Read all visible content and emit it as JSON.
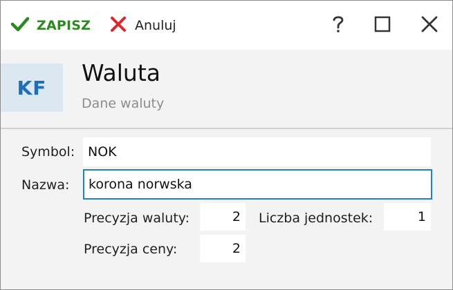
{
  "toolbar": {
    "save_label": "ZAPISZ",
    "cancel_label": "Anuluj"
  },
  "header": {
    "badge": "KF",
    "title": "Waluta",
    "subtitle": "Dane waluty"
  },
  "form": {
    "symbol": {
      "label": "Symbol:",
      "value": "NOK"
    },
    "name": {
      "label": "Nazwa:",
      "value": "korona norwska"
    },
    "currency_precision": {
      "label": "Precyzja waluty:",
      "value": "2"
    },
    "unit_count": {
      "label": "Liczba jednostek:",
      "value": "1"
    },
    "price_precision": {
      "label": "Precyzja ceny:",
      "value": "2"
    }
  },
  "colors": {
    "save_accent": "#2b8a1f",
    "cancel_accent": "#e0242a",
    "badge_bg": "#dbe8f2",
    "badge_text": "#1f6fb8",
    "focus_border": "#1e7fd0"
  },
  "icons": {
    "save": "check-icon",
    "cancel": "x-icon",
    "help": "question-icon",
    "maximize": "maximize-icon",
    "close": "close-icon"
  }
}
